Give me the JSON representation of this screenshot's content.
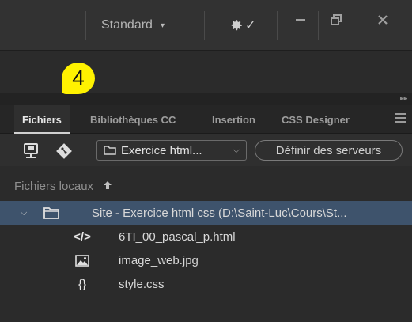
{
  "titlebar": {
    "workspace_label": "Standard",
    "workspace_caret": "▾",
    "sync_check": "✓"
  },
  "callout": {
    "number": "4"
  },
  "tabs": [
    {
      "label": "Fichiers",
      "active": true
    },
    {
      "label": "Bibliothèques CC",
      "active": false
    },
    {
      "label": "Insertion",
      "active": false
    },
    {
      "label": "CSS Designer",
      "active": false
    }
  ],
  "toolbar": {
    "site_select_value": "Exercice html...",
    "site_select_chevron": "⌵",
    "define_servers_label": "Définir des serveurs"
  },
  "local_files": {
    "header": "Fichiers locaux",
    "up_arrow": "🡑"
  },
  "tree": {
    "site_row": {
      "expander": "⌵",
      "label": "Site - Exercice html css (D:\\Saint-Luc\\Cours\\St..."
    },
    "files": [
      {
        "icon": "code-icon",
        "glyph": "</>",
        "name": "6TI_00_pascal_p.html"
      },
      {
        "icon": "image-icon",
        "glyph": "",
        "name": "image_web.jpg"
      },
      {
        "icon": "css-braces-icon",
        "glyph": "{}",
        "name": "style.css"
      }
    ]
  },
  "colors": {
    "callout": "#fff200",
    "selected_row": "#3e536c",
    "panel_bg": "#2b2b2b"
  }
}
